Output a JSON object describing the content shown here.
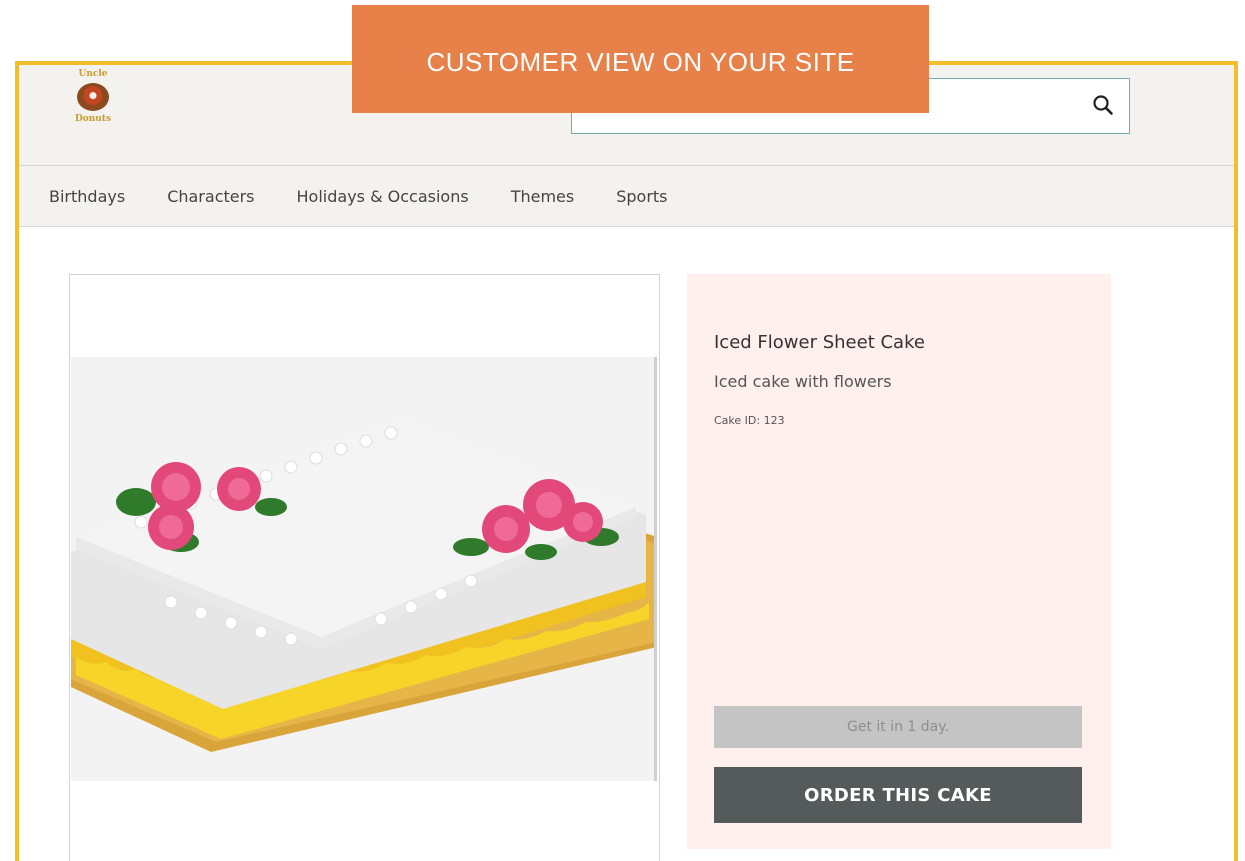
{
  "banner": {
    "text": "CUSTOMER VIEW ON YOUR SITE"
  },
  "header": {
    "logo_top": "Uncle",
    "logo_bottom": "Donuts",
    "search_icon": "search-icon"
  },
  "nav": {
    "items": [
      {
        "label": "Birthdays"
      },
      {
        "label": "Characters"
      },
      {
        "label": "Holidays & Occasions"
      },
      {
        "label": "Themes"
      },
      {
        "label": "Sports"
      }
    ]
  },
  "product": {
    "title": "Iced Flower Sheet Cake",
    "description": "Iced cake with flowers",
    "cake_id": "Cake ID: 123",
    "delivery": "Get it in 1 day.",
    "order_label": "ORDER THIS CAKE",
    "zoom_icon": "zoom-out-icon"
  },
  "colors": {
    "frame": "#f2bf2a",
    "banner": "#e8804a",
    "details_bg": "#fff0ee",
    "order_button": "#555a5b"
  }
}
